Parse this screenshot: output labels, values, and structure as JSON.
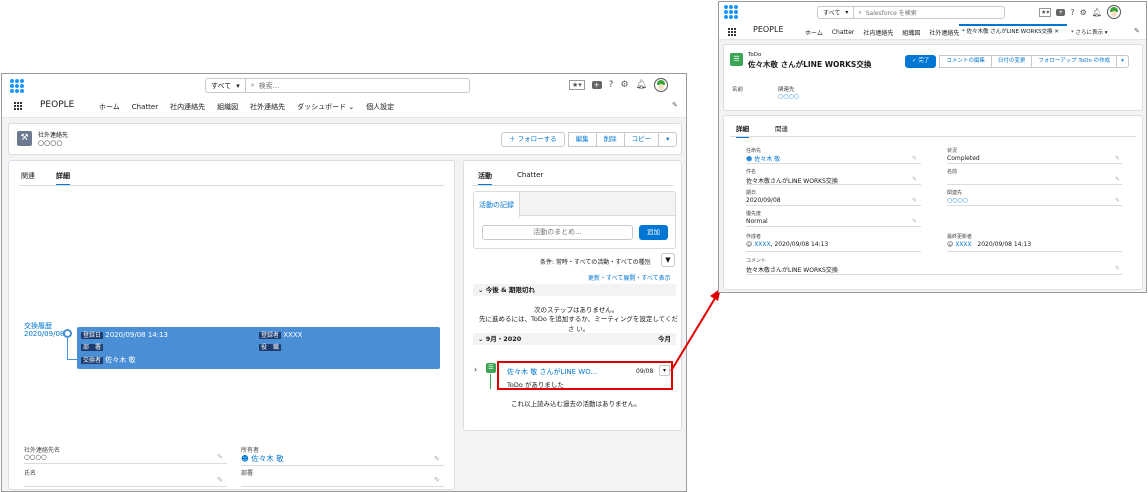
{
  "left": {
    "search_scope": "すべて",
    "search_placeholder": "検索...",
    "app_name": "PEOPLE",
    "nav": [
      "ホーム",
      "Chatter",
      "社内連絡先",
      "組織図",
      "社外連絡先",
      "ダッシュボード",
      "個人設定"
    ],
    "record_type": "社外連絡先",
    "record_name": "○○○○",
    "actions": [
      "＋ フォローする",
      "編集",
      "削除",
      "コピー"
    ],
    "tabs": [
      "関連",
      "詳細"
    ],
    "history_label": "交換履歴",
    "history_date": "2020/09/08",
    "card_fields": {
      "reg_date_label": "登録日",
      "reg_date": "2020/09/08 14:13",
      "registrant_label": "登録者",
      "registrant": "XXXX",
      "dept_label": "部　署",
      "role_label": "役　職",
      "exchanger_label": "交換者",
      "exchanger": "佐々木 敬"
    },
    "bottom_fields": {
      "contact_name_label": "社外連絡先名",
      "contact_name": "○○○○",
      "owner_label": "所有者",
      "owner": "佐々木 敬",
      "name_label": "氏名",
      "dept_label": "部署"
    },
    "activity": {
      "tabs": [
        "活動",
        "Chatter"
      ],
      "log_tab": "活動の記録",
      "summary_placeholder": "活動のまとめ...",
      "add_button": "追加",
      "filter_text": "条件: 常時・すべての活動・すべての種別",
      "links": "更新・すべて展開・すべて表示",
      "upcoming_header": "今後 & 期限切れ",
      "no_steps_1": "次のステップはありません。",
      "no_steps_2": "先に進めるには、ToDo を追加するか、ミーティングを設定してくださ い。",
      "month_header": "9月・2020",
      "month_right": "今月",
      "todo_title": "佐々木 敬 さんがLINE WO...",
      "todo_date": "09/08",
      "todo_sub": "ToDo がありました",
      "no_more": "これ以上読み込む過去の活動はありません。"
    }
  },
  "right": {
    "search_scope": "すべて",
    "search_placeholder": "Salesforce を検索",
    "app_name": "PEOPLE",
    "nav": [
      "ホーム",
      "Chatter",
      "社内連絡先",
      "組織図",
      "社外連絡先"
    ],
    "active_tab": "* 佐々木敬 さんがLINE WORKS交換",
    "more_tab": "* さらに表示",
    "record_type": "ToDo",
    "record_title": "佐々木敬 さんがLINE WORKS交換",
    "actions": [
      "✓ 完了",
      "コメントの編集",
      "日付の変更",
      "フォローアップ ToDo の作成"
    ],
    "name_label": "名前",
    "related_label": "関連先",
    "related_value": "○○○○",
    "tabs": [
      "詳細",
      "関連"
    ],
    "fields": {
      "assignee_label": "任命先",
      "assignee": "佐々木 敬",
      "status_label": "状況",
      "status": "Completed",
      "subject_label": "件名",
      "subject": "佐々木敬さんがLINE WORKS交換",
      "name_label": "名前",
      "due_label": "期日",
      "due": "2020/09/08",
      "related_label": "関連先",
      "related": "○○○○",
      "priority_label": "優先度",
      "priority": "Normal",
      "creator_label": "作成者",
      "creator": "XXXX",
      "creator_date": ", 2020/09/08 14:13",
      "modifier_label": "最終更新者",
      "modifier": "XXXX",
      "modifier_date": "2020/09/08 14:13",
      "comment_label": "コメント",
      "comment": "佐々木敬さんがLINE WORKS交換"
    }
  },
  "colors": {
    "brand": "#0176d3",
    "header_blue": "#4a8ed6",
    "highlight": "#e00000"
  }
}
